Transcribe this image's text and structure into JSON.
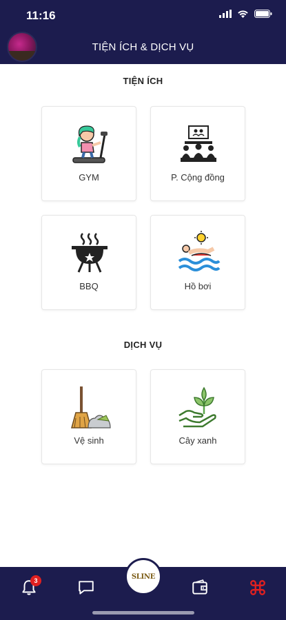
{
  "status": {
    "time": "11:16"
  },
  "header": {
    "title": "TIỆN ÍCH & DỊCH VỤ"
  },
  "sections": [
    {
      "title": "TIỆN ÍCH",
      "items": [
        {
          "label": "GYM",
          "icon": "treadmill-icon"
        },
        {
          "label": "P. Cộng đồng",
          "icon": "community-room-icon"
        },
        {
          "label": "BBQ",
          "icon": "bbq-grill-icon"
        },
        {
          "label": "Hồ bơi",
          "icon": "swimming-icon"
        }
      ]
    },
    {
      "title": "DỊCH VỤ",
      "items": [
        {
          "label": "Vệ sinh",
          "icon": "broom-icon"
        },
        {
          "label": "Cây xanh",
          "icon": "plant-hand-icon"
        }
      ]
    }
  ],
  "bottom_nav": {
    "notification_count": "3",
    "home_logo": "SLINE",
    "items": [
      "bell-icon",
      "chat-icon",
      "home-logo",
      "wallet-icon",
      "command-icon"
    ]
  },
  "colors": {
    "header_bg": "#1c1c4e",
    "accent_red": "#e02020"
  }
}
